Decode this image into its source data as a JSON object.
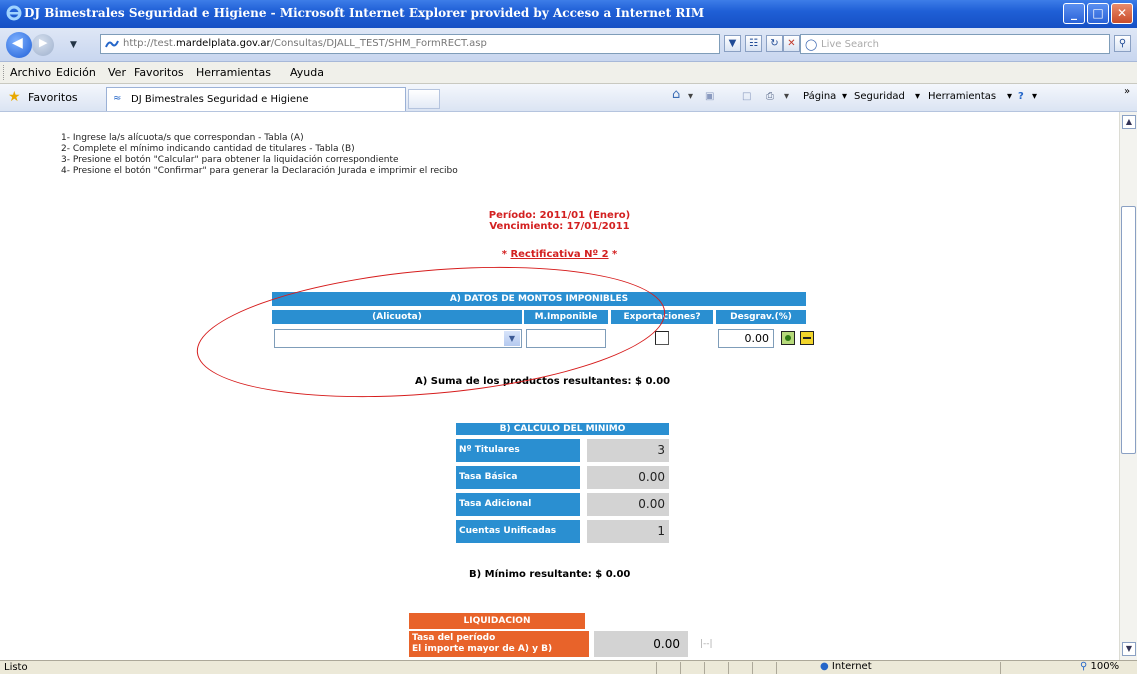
{
  "window": {
    "title": "DJ Bimestrales Seguridad e Higiene - Microsoft Internet Explorer provided by Acceso a Internet RIM"
  },
  "address": {
    "url_prefix": "http://test.",
    "url_domain": "mardelplata.gov.ar",
    "url_path": "/Consultas/DJALL_TEST/SHM_FormRECT.asp",
    "search_placeholder": "Live Search"
  },
  "menu": [
    "Archivo",
    "Edición",
    "Ver",
    "Favoritos",
    "Herramientas",
    "Ayuda"
  ],
  "favorites": {
    "label": "Favoritos",
    "tab_label": "DJ Bimestrales Seguridad e Higiene"
  },
  "command_bar": {
    "pagina": "Página",
    "seguridad": "Seguridad",
    "herramientas": "Herramientas"
  },
  "content": {
    "instructions": [
      "1- Ingrese la/s alícuota/s que correspondan - Tabla (A)",
      "2- Complete el mínimo indicando cantidad de titulares - Tabla (B)",
      "3- Presione el botón \"Calcular\" para obtener la liquidación correspondiente",
      "4- Presione el botón \"Confirmar\" para generar la Declaración Jurada e imprimir el recibo"
    ],
    "periodo": "Período: 2011/01 (Enero)",
    "vencimiento": "Vencimiento: 17/01/2011",
    "rect_star_left": "* ",
    "rectificativa": "Rectificativa Nº 2",
    "rect_star_right": " *",
    "table_a": {
      "title": "A) DATOS DE MONTOS IMPONIBLES",
      "columns": [
        "(Alicuota)",
        "M.Imponible",
        "Exportaciones?",
        "Desgrav.(%)"
      ],
      "desgrav_value": "0.00",
      "suma_label": "A) Suma de los productos resultantes: $",
      "suma_value": "0.00"
    },
    "table_b": {
      "title": "B) CALCULO DEL MINIMO",
      "rows": [
        {
          "label": "Nº Titulares",
          "value": "3"
        },
        {
          "label": "Tasa Básica",
          "value": "0.00"
        },
        {
          "label": "Tasa Adicional",
          "value": "0.00"
        },
        {
          "label": "Cuentas Unificadas",
          "value": "1"
        }
      ],
      "minimo_label": "B) Mínimo resultante: $",
      "minimo_value": "0.00"
    },
    "liquidacion": {
      "title": "LIQUIDACION",
      "row_label_1": "Tasa del período",
      "row_label_2": "El importe mayor de A) y B)",
      "row_value": "0.00"
    }
  },
  "status": {
    "text": "Listo",
    "zone": "Internet",
    "zoom": "100%"
  },
  "colors": {
    "header_blue": "#2a8fd1",
    "header_orange": "#e8632a",
    "accent_red": "#d32020"
  }
}
